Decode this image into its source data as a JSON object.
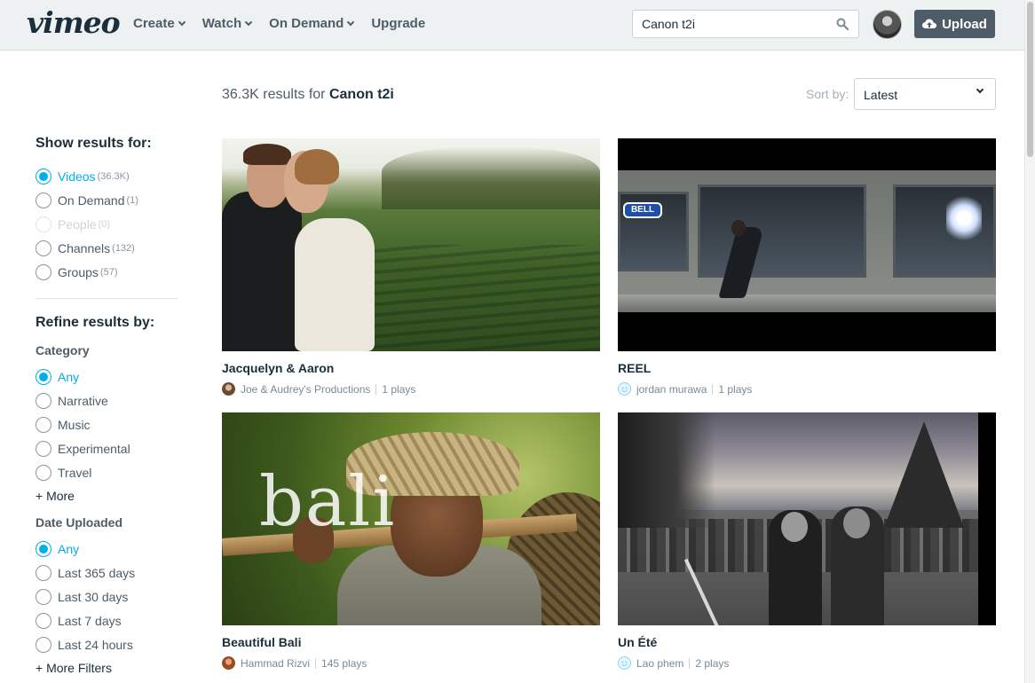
{
  "header": {
    "logo": "vimeo",
    "nav": [
      {
        "label": "Create",
        "has_dropdown": true
      },
      {
        "label": "Watch",
        "has_dropdown": true
      },
      {
        "label": "On Demand",
        "has_dropdown": true
      },
      {
        "label": "Upgrade",
        "has_dropdown": false
      }
    ],
    "search_value": "Canon t2i",
    "search_icon": "search-icon",
    "upload_label": "Upload",
    "upload_icon": "cloud-upload-icon"
  },
  "results": {
    "count": "36.3K",
    "text": "results for",
    "query": "Canon t2i",
    "sort_label": "Sort by:",
    "sort_value": "Latest"
  },
  "sidebar": {
    "show_heading": "Show results for:",
    "show_options": [
      {
        "label": "Videos",
        "count": "(36.3K)",
        "checked": true,
        "disabled": false
      },
      {
        "label": "On Demand",
        "count": "(1)",
        "checked": false,
        "disabled": false
      },
      {
        "label": "People",
        "count": "(0)",
        "checked": false,
        "disabled": true
      },
      {
        "label": "Channels",
        "count": "(132)",
        "checked": false,
        "disabled": false
      },
      {
        "label": "Groups",
        "count": "(57)",
        "checked": false,
        "disabled": false
      }
    ],
    "refine_heading": "Refine results by:",
    "category_heading": "Category",
    "category_options": [
      "Any",
      "Narrative",
      "Music",
      "Experimental",
      "Travel"
    ],
    "category_more": "+ More",
    "date_heading": "Date Uploaded",
    "date_options": [
      "Any",
      "Last 365 days",
      "Last 30 days",
      "Last 7 days",
      "Last 24 hours"
    ],
    "more_filters": "+ More Filters"
  },
  "videos": [
    {
      "title": "Jacquelyn & Aaron",
      "owner": "Joe & Audrey's Productions",
      "plays": "1 plays",
      "avatar_color": "#8a5a3a"
    },
    {
      "title": "REEL",
      "owner": "jordan murawa",
      "plays": "1 plays",
      "avatar_color": "#7fd0f0"
    },
    {
      "title": "Beautiful Bali",
      "owner": "Hammad Rizvi",
      "plays": "145 plays",
      "avatar_color": "#c0622b"
    },
    {
      "title": "Un Été",
      "owner": "Lao phem",
      "plays": "2 plays",
      "avatar_color": "#7fd0f0"
    }
  ],
  "thumb_text": {
    "bali": "bali",
    "bell": "BELL"
  },
  "colors": {
    "accent": "#00adef",
    "text": "#1a2e3b",
    "muted": "#7b8a94",
    "header_bg": "#eef1f2",
    "upload_bg": "#4e5c67"
  }
}
